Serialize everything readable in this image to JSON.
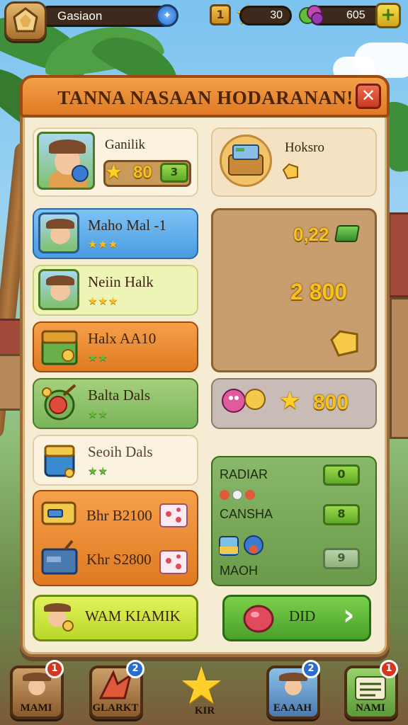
{
  "hud": {
    "player_name": "Gasiaon",
    "level": "1",
    "stars": "30",
    "gems": "605",
    "plus": "+"
  },
  "panel": {
    "title": "TANNA NASAAN HODARANAN!",
    "close": "✕"
  },
  "profile": {
    "name": "Ganilik",
    "score": "80",
    "score_badge": "3"
  },
  "shop": {
    "label": "Hoksro"
  },
  "quests": [
    {
      "title": "Maho Mal -1",
      "stars": "★★★"
    },
    {
      "title": "Neiin Halk",
      "stars": "★★★"
    },
    {
      "title": "Halx AA10",
      "stars": "★★"
    },
    {
      "title": "Balta Dals",
      "stars": "★★"
    },
    {
      "title": "Seoih Dals",
      "stars": "★★"
    }
  ],
  "chests": [
    {
      "title": "Bhr B2100"
    },
    {
      "title": "Khr S2800"
    }
  ],
  "rewards": {
    "value1": "0,22",
    "value2": "2 800",
    "stars_reward": "800"
  },
  "settings": [
    {
      "label": "RADIAR",
      "value": "0"
    },
    {
      "label": "CANSHA",
      "value": "8"
    },
    {
      "label": "MAOH",
      "value": "9"
    }
  ],
  "footer": {
    "left_button": "WAM KIAMIK",
    "right_button": "DID",
    "right_arrow": "›"
  },
  "nav": [
    {
      "label": "MAMI",
      "badge": "1"
    },
    {
      "label": "GLARKT",
      "badge": "2"
    },
    {
      "label": "KIR",
      "badge": ""
    },
    {
      "label": "EAAAH",
      "badge": "2"
    },
    {
      "label": "NAMI",
      "badge": "1"
    }
  ]
}
